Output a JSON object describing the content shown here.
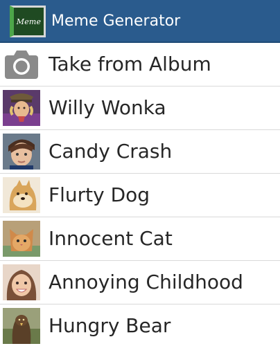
{
  "action_bar": {
    "logo_text": "Meme",
    "title": "Meme Generator",
    "color": "#2a5b8d"
  },
  "items": [
    {
      "label": "Take from Album",
      "icon": "camera-icon"
    },
    {
      "label": "Willy Wonka",
      "icon": "willy-wonka-thumbnail"
    },
    {
      "label": "Candy Crash",
      "icon": "candy-crash-thumbnail"
    },
    {
      "label": "Flurty Dog",
      "icon": "flurty-dog-thumbnail"
    },
    {
      "label": "Innocent Cat",
      "icon": "innocent-cat-thumbnail"
    },
    {
      "label": "Annoying Childhood",
      "icon": "annoying-childhood-thumbnail"
    },
    {
      "label": "Hungry Bear",
      "icon": "hungry-bear-thumbnail"
    }
  ]
}
